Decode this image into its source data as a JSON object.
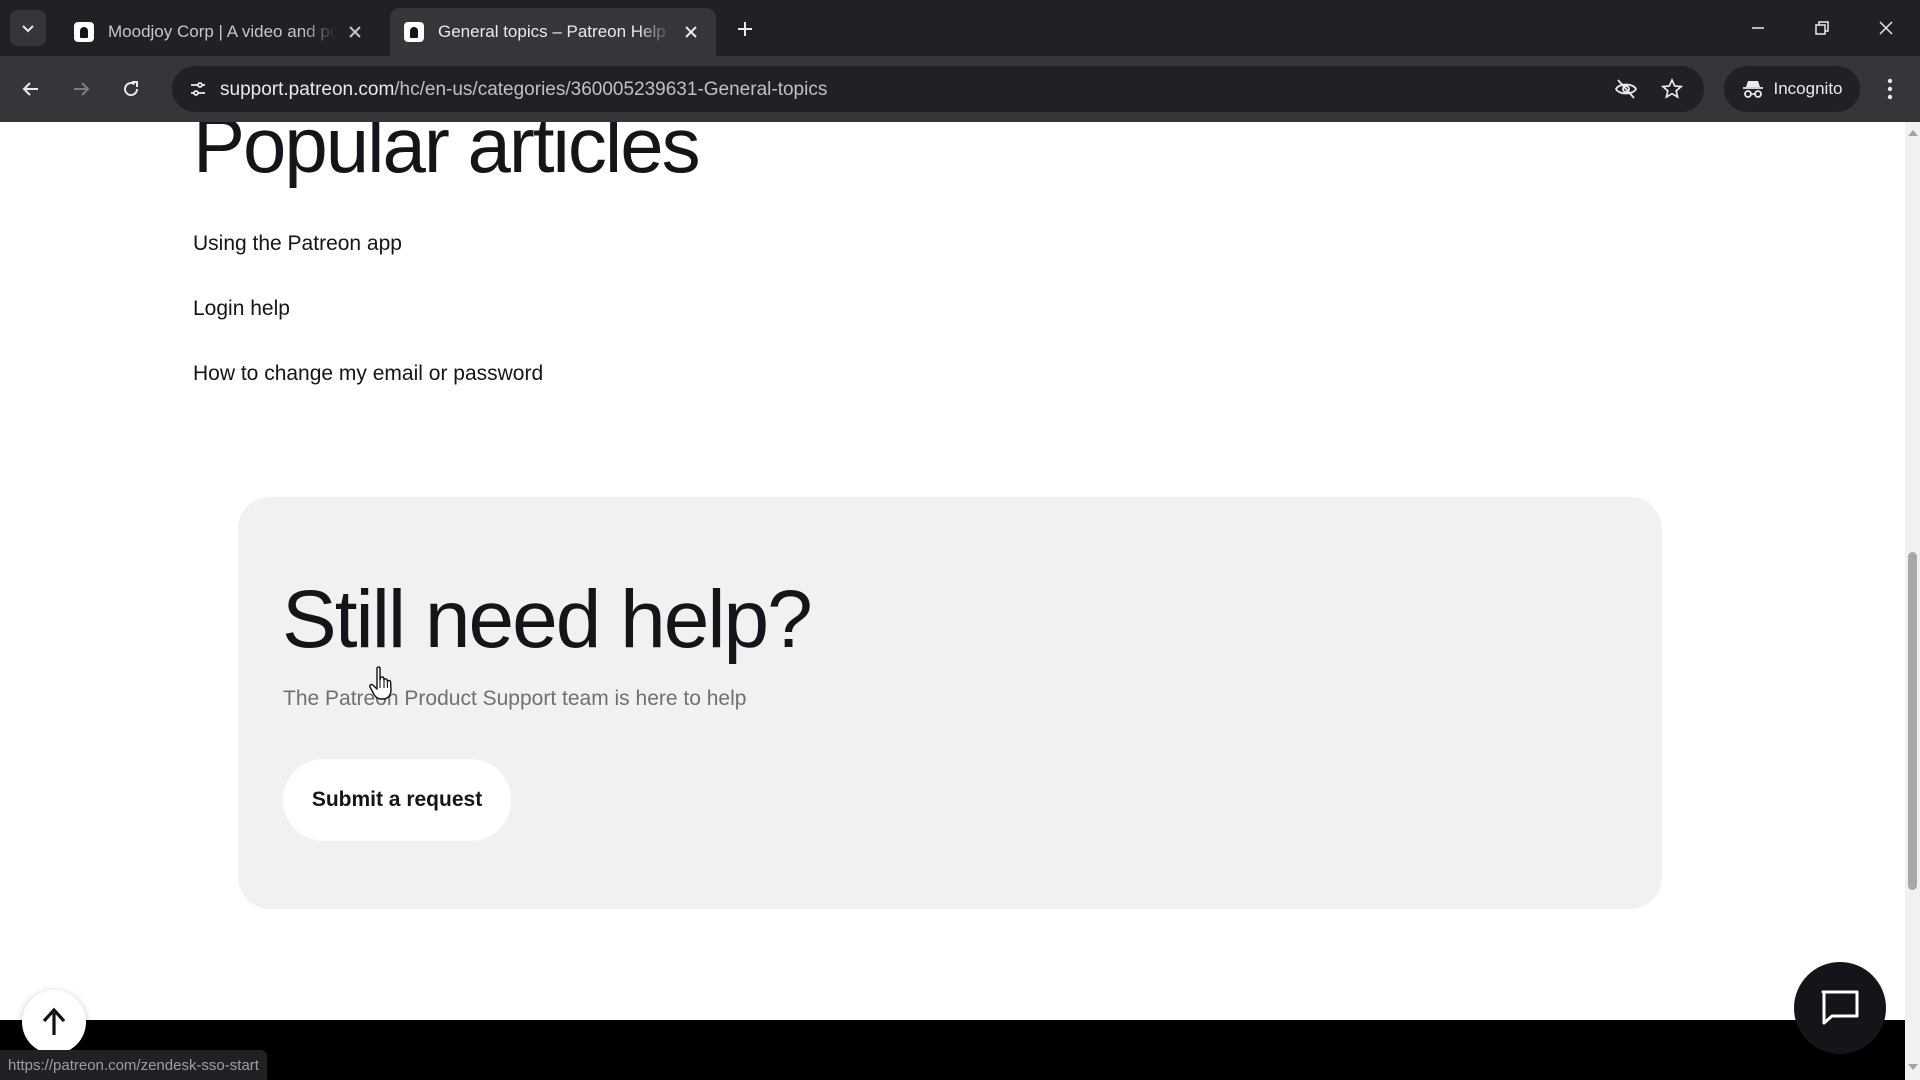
{
  "browser": {
    "tabs": [
      {
        "title": "Moodjoy Corp | A video and podcast creator | Patreon",
        "active": false
      },
      {
        "title": "General topics – Patreon Help Center",
        "active": true
      }
    ],
    "url_host": "support.patreon.com",
    "url_path": "/hc/en-us/categories/360005239631-General-topics",
    "incognito_label": "Incognito",
    "status_url": "https://patreon.com/zendesk-sso-start"
  },
  "popular": {
    "heading": "Popular articles",
    "articles": [
      "Using the Patreon app",
      "Login help",
      "How to change my email or password"
    ]
  },
  "help_card": {
    "title": "Still need help?",
    "subtitle": "The Patreon Product Support team is here to help",
    "button_label": "Submit a request"
  },
  "colors": {
    "chrome_dark": "#202124",
    "chrome_toolbar": "#35363a",
    "card_bg": "#f1f1f2",
    "text_primary": "#141518",
    "text_muted": "#707074"
  },
  "icons": {
    "tab_search": "chevron-down-icon",
    "favicon": "patreon-logo-icon",
    "tab_close": "close-icon",
    "new_tab": "plus-icon",
    "back": "arrow-left-icon",
    "forward": "arrow-right-icon",
    "reload": "reload-icon",
    "site_info": "tune-icon",
    "tracking": "eye-off-icon",
    "bookmark": "star-icon",
    "incognito": "incognito-icon",
    "menu": "kebab-menu-icon",
    "back_to_top": "arrow-up-icon",
    "chat": "chat-icon"
  }
}
